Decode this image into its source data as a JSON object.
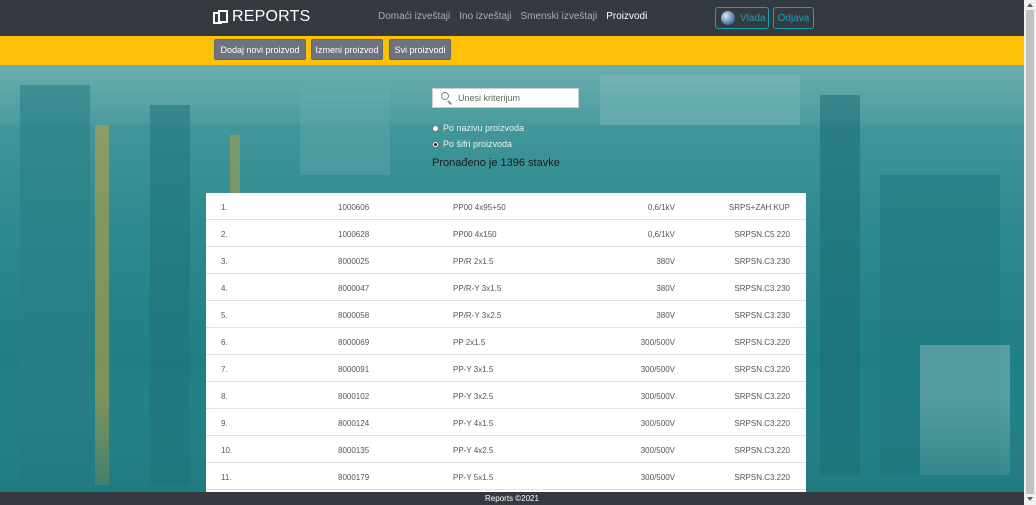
{
  "brand": {
    "title": "REPORTS",
    "icon": "copy-icon"
  },
  "nav": {
    "links": [
      "Domaći izveštaji",
      "Ino izveštaji",
      "Smenski izveštaji",
      "Proizvodi"
    ],
    "active": "Proizvodi",
    "user_label": "Vlada",
    "logout_label": "Odjava"
  },
  "actions": {
    "add_label": "Dodaj novi proizvod",
    "edit_label": "Izmeni proizvod",
    "all_label": "Svi proizvodi"
  },
  "search": {
    "placeholder": "Unesi kriterijum",
    "value": "",
    "option_name": "Po nazivu proizvoda",
    "option_id": "Po šifri proizvoda",
    "selected": "Po šifri proizvoda"
  },
  "found_text": "Pronađeno je 1396 stavke",
  "table": {
    "rows": [
      [
        "1.",
        "1000606",
        "PP00 4x95+50",
        "0,6/1kV",
        "SRPS+ZAH.KUP"
      ],
      [
        "2.",
        "1000628",
        "PP00 4x150",
        "0,6/1kV",
        "SRPSN.C5 220"
      ],
      [
        "3.",
        "8000025",
        "PP/R 2x1.5",
        "380V",
        "SRPSN.C3.230"
      ],
      [
        "4.",
        "8000047",
        "PP/R-Y 3x1.5",
        "380V",
        "SRPSN.C3.230"
      ],
      [
        "5.",
        "8000058",
        "PP/R-Y 3x2.5",
        "380V",
        "SRPSN.C3.230"
      ],
      [
        "6.",
        "8000069",
        "PP 2x1.5",
        "300/500V",
        "SRPSN.C3.220"
      ],
      [
        "7.",
        "8000091",
        "PP-Y 3x1.5",
        "300/500V",
        "SRPSN.C3.220"
      ],
      [
        "8.",
        "8000102",
        "PP-Y 3x2.5",
        "300/500V",
        "SRPSN.C3.220"
      ],
      [
        "9.",
        "8000124",
        "PP-Y 4x1.5",
        "300/500V",
        "SRPSN.C3.220"
      ],
      [
        "10.",
        "8000135",
        "PP-Y 4x2.5",
        "300/500V",
        "SRPSN.C3.220"
      ],
      [
        "11.",
        "8000179",
        "PP-Y 5x1.5",
        "300/500V",
        "SRPSN.C3.220"
      ]
    ]
  },
  "footer": {
    "text": "Reports ©2021"
  },
  "colors": {
    "navbar": "#343a40",
    "accent_bar": "#ffc107",
    "button": "#6c757d",
    "outline": "#17a2b8",
    "background_tint": "#2f8b8f"
  }
}
